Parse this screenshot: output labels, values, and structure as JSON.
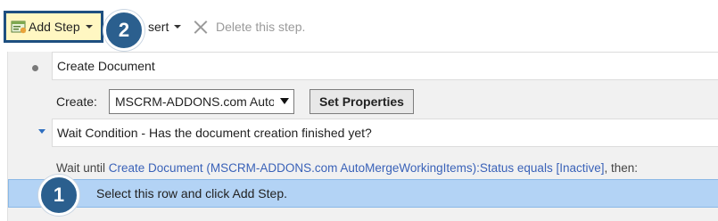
{
  "toolbar": {
    "add_step_label": "Add Step",
    "insert_label": "sert",
    "delete_label": "Delete this step."
  },
  "badges": {
    "one": "1",
    "two": "2"
  },
  "step": {
    "document_title": "Create Document",
    "create_label": "Create:",
    "entity_selected": "MSCRM-ADDONS.com AutoMergeWorkingItems",
    "set_properties_label": "Set Properties",
    "wait_condition_title": "Wait Condition - Has the document creation finished yet?",
    "wait_until_prefix": "Wait until ",
    "wait_until_link": "Create Document (MSCRM-ADDONS.com AutoMergeWorkingItems):Status equals [Inactive]",
    "wait_until_suffix": ", then:",
    "selected_row_text": "Select this row and click Add Step."
  },
  "colors": {
    "badge": "#2b5f8e",
    "selection": "#b3d3f5",
    "link": "#3a62b8",
    "highlight": "#fff7c2"
  }
}
